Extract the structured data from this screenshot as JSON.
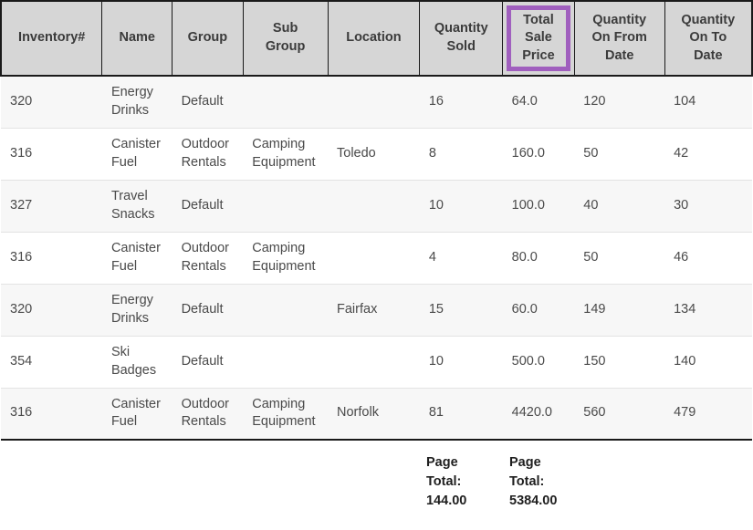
{
  "table": {
    "columns": [
      {
        "key": "inventory",
        "label": "Inventory#",
        "highlighted": false
      },
      {
        "key": "name",
        "label": "Name",
        "highlighted": false
      },
      {
        "key": "group",
        "label": "Group",
        "highlighted": false
      },
      {
        "key": "sub_group",
        "label": "Sub Group",
        "highlighted": false
      },
      {
        "key": "location",
        "label": "Location",
        "highlighted": false
      },
      {
        "key": "quantity_sold",
        "label": "Quantity Sold",
        "highlighted": false
      },
      {
        "key": "total_sale",
        "label": "Total Sale Price",
        "highlighted": true
      },
      {
        "key": "qty_on_from",
        "label": "Quantity On From Date",
        "highlighted": false
      },
      {
        "key": "qty_on_to",
        "label": "Quantity On To Date",
        "highlighted": false
      }
    ],
    "header_labels": {
      "inventory": "Inventory#",
      "name": "Name",
      "group": "Group",
      "sub_group_line1": "Sub",
      "sub_group_line2": "Group",
      "location": "Location",
      "quantity_sold_line1": "Quantity",
      "quantity_sold_line2": "Sold",
      "total_sale_line1": "Total",
      "total_sale_line2": "Sale",
      "total_sale_line3": "Price",
      "qty_on_from_line1": "Quantity",
      "qty_on_from_line2": "On From",
      "qty_on_from_line3": "Date",
      "qty_on_to_line1": "Quantity",
      "qty_on_to_line2": "On To",
      "qty_on_to_line3": "Date"
    },
    "rows": [
      {
        "inventory": "320",
        "name": "Energy Drinks",
        "group": "Default",
        "sub_group": "",
        "location": "",
        "quantity_sold": "16",
        "total_sale": "64.0",
        "qty_on_from": "120",
        "qty_on_to": "104"
      },
      {
        "inventory": "316",
        "name": "Canister Fuel",
        "group": "Outdoor Rentals",
        "sub_group": "Camping Equipment",
        "location": "Toledo",
        "quantity_sold": "8",
        "total_sale": "160.0",
        "qty_on_from": "50",
        "qty_on_to": "42"
      },
      {
        "inventory": "327",
        "name": "Travel Snacks",
        "group": "Default",
        "sub_group": "",
        "location": "",
        "quantity_sold": "10",
        "total_sale": "100.0",
        "qty_on_from": "40",
        "qty_on_to": "30"
      },
      {
        "inventory": "316",
        "name": "Canister Fuel",
        "group": "Outdoor Rentals",
        "sub_group": "Camping Equipment",
        "location": "",
        "quantity_sold": "4",
        "total_sale": "80.0",
        "qty_on_from": "50",
        "qty_on_to": "46"
      },
      {
        "inventory": "320",
        "name": "Energy Drinks",
        "group": "Default",
        "sub_group": "",
        "location": "Fairfax",
        "quantity_sold": "15",
        "total_sale": "60.0",
        "qty_on_from": "149",
        "qty_on_to": "134"
      },
      {
        "inventory": "354",
        "name": "Ski Badges",
        "group": "Default",
        "sub_group": "",
        "location": "",
        "quantity_sold": "10",
        "total_sale": "500.0",
        "qty_on_from": "150",
        "qty_on_to": "140"
      },
      {
        "inventory": "316",
        "name": "Canister Fuel",
        "group": "Outdoor Rentals",
        "sub_group": "Camping Equipment",
        "location": "Norfolk",
        "quantity_sold": "81",
        "total_sale": "4420.0",
        "qty_on_from": "560",
        "qty_on_to": "479"
      }
    ],
    "footer": {
      "quantity_sold_total_label_line1": "Page",
      "quantity_sold_total_label_line2": "Total:",
      "quantity_sold_total_value": "144.00",
      "total_sale_total_label_line1": "Page",
      "total_sale_total_label_line2": "Total:",
      "total_sale_total_value": "5384.00"
    }
  },
  "colors": {
    "header_background": "#d6d6d6",
    "header_border": "#1a1a1a",
    "highlight_border": "#a05fbe",
    "row_odd_background": "#f7f7f7",
    "row_even_background": "#ffffff",
    "row_divider": "#e3e3e3",
    "body_text": "#4a4a4a",
    "header_text": "#3b3b3b"
  }
}
